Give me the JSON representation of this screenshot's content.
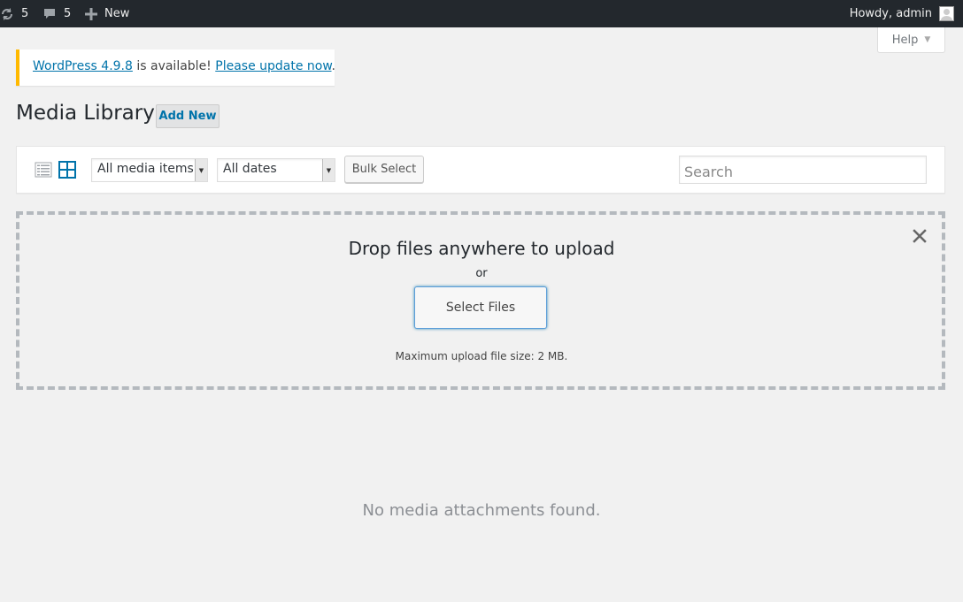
{
  "adminbar": {
    "updates_count": "5",
    "comments_count": "5",
    "new_label": "New",
    "greeting": "Howdy, admin"
  },
  "help": {
    "label": "Help"
  },
  "notice": {
    "version_link": "WordPress 4.9.8",
    "middle_text": " is available! ",
    "update_link": "Please update now",
    "end_text": "."
  },
  "page": {
    "title": "Media Library",
    "add_new": "Add New"
  },
  "toolbar": {
    "type_filter": "All media items",
    "date_filter": "All dates",
    "bulk_select": "Bulk Select",
    "search_placeholder": "Search"
  },
  "uploader": {
    "title": "Drop files anywhere to upload",
    "or": "or",
    "select_files": "Select Files",
    "max_size": "Maximum upload file size: 2 MB."
  },
  "empty": {
    "message": "No media attachments found."
  },
  "icons": {
    "updates": "refresh-icon",
    "comments": "comment-icon",
    "new": "plus-icon",
    "list_view": "list-view-icon",
    "grid_view": "grid-view-icon",
    "close": "close-icon"
  },
  "colors": {
    "adminbar": "#23282d",
    "link": "#0073aa",
    "notice_border": "#ffb900",
    "background": "#f1f1f1"
  }
}
